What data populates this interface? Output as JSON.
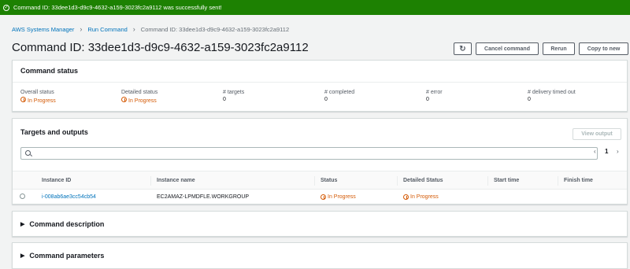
{
  "flash": {
    "message": "Command ID: 33dee1d3-d9c9-4632-a159-3023fc2a9112 was successfully sent!",
    "icon": "check-circle-icon"
  },
  "breadcrumbs": [
    "AWS Systems Manager",
    "Run Command",
    "Command ID: 33dee1d3-d9c9-4632-a159-3023fc2a9112"
  ],
  "page_title": "Command ID: 33dee1d3-d9c9-4632-a159-3023fc2a9112",
  "buttons": {
    "refresh_icon": "refresh-icon",
    "cancel": "Cancel command",
    "rerun": "Rerun",
    "copy": "Copy to new"
  },
  "command_status": {
    "title": "Command status",
    "items": [
      {
        "label": "Overall status",
        "value": "In Progress"
      },
      {
        "label": "Detailed status",
        "value": "In Progress"
      },
      {
        "label": "# targets",
        "value": "0"
      },
      {
        "label": "# completed",
        "value": "0"
      },
      {
        "label": "# error",
        "value": "0"
      },
      {
        "label": "# delivery timed out",
        "value": "0"
      }
    ]
  },
  "targets": {
    "title": "Targets and outputs",
    "view_output": "View output",
    "search_placeholder": "",
    "page": "1",
    "columns": [
      "Instance ID",
      "Instance name",
      "Status",
      "Detailed Status",
      "Start time",
      "Finish time"
    ],
    "rows": [
      {
        "instance_id": "i-008ab6ae3cc54cb54",
        "instance_name": "EC2AMAZ-LPMDFLE.WORKGROUP",
        "status": "In Progress",
        "detailed_status": "In Progress",
        "start_time": "",
        "finish_time": ""
      }
    ]
  },
  "sections": {
    "description": "Command description",
    "parameters": "Command parameters"
  },
  "colors": {
    "success": "#1d8102",
    "link": "#0073bb",
    "in_progress": "#d45b07"
  }
}
